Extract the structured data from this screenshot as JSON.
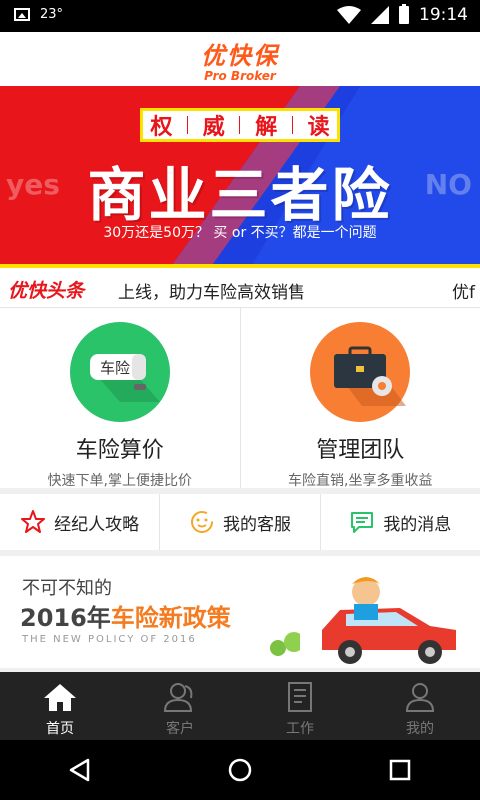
{
  "status": {
    "temperature": "23°",
    "time": "19:14"
  },
  "app": {
    "logo_cn": "优快保",
    "logo_en": "Pro Broker"
  },
  "banner": {
    "tag_chars": [
      "权",
      "威",
      "解",
      "读"
    ],
    "title": "商业三者险",
    "subtitle": "30万还是50万？  买 or 不买？都是一个问题",
    "yes": "yes",
    "no": "NO",
    "colors": {
      "left": "#e8151b",
      "right": "#1e3fe0",
      "tag_border": "#ffe100"
    }
  },
  "ticker": {
    "brand": "优快头条",
    "text": "上线，助力车险高效销售",
    "tail": "优f"
  },
  "features": [
    {
      "title": "车险算价",
      "subtitle": "快速下单,掌上便捷比价",
      "icon": "car-insurance-icon",
      "badge": "车险",
      "color": "#2bc36a"
    },
    {
      "title": "管理团队",
      "subtitle": "车险直销,坐享多重收益",
      "icon": "briefcase-icon",
      "color": "#f77e33"
    }
  ],
  "quick_links": [
    {
      "label": "经纪人攻略",
      "icon": "star-icon",
      "color": "#e8151b"
    },
    {
      "label": "我的客服",
      "icon": "smiley-chat-icon",
      "color": "#f5a623"
    },
    {
      "label": "我的消息",
      "icon": "message-icon",
      "color": "#2bc36a"
    }
  ],
  "promo": {
    "line1": "不可不知的",
    "year": "2016年",
    "highlight": "车险新政策",
    "en": "THE NEW POLICY OF 2016"
  },
  "tabs": [
    {
      "label": "首页",
      "icon": "home-icon",
      "active": true
    },
    {
      "label": "客户",
      "icon": "customers-icon",
      "active": false
    },
    {
      "label": "工作",
      "icon": "work-icon",
      "active": false
    },
    {
      "label": "我的",
      "icon": "profile-icon",
      "active": false
    }
  ]
}
